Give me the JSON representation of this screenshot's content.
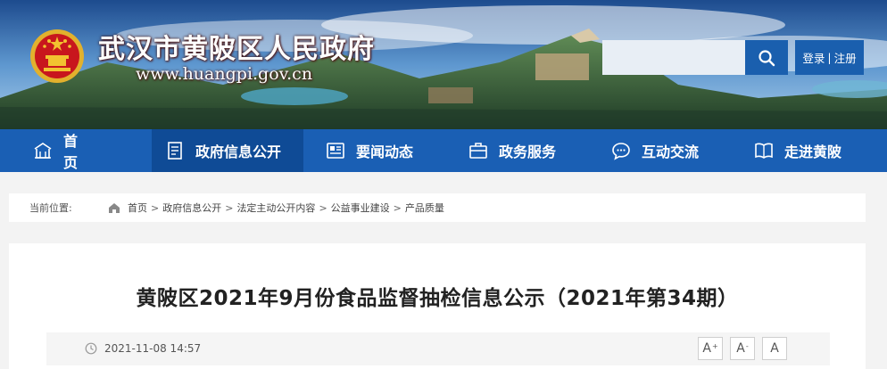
{
  "site": {
    "title": "武汉市黄陂区人民政府",
    "url": "www.huangpi.gov.cn",
    "emblem_icon": "national-emblem-icon"
  },
  "search": {
    "placeholder": "",
    "value": "",
    "icon": "search-icon"
  },
  "auth": {
    "login": "登录",
    "separator": "|",
    "register": "注册"
  },
  "nav": {
    "items": [
      {
        "label": "首页",
        "icon": "home-icon",
        "active": false
      },
      {
        "label": "政府信息公开",
        "icon": "document-icon",
        "active": true
      },
      {
        "label": "要闻动态",
        "icon": "newspaper-icon",
        "active": false
      },
      {
        "label": "政务服务",
        "icon": "briefcase-icon",
        "active": false
      },
      {
        "label": "互动交流",
        "icon": "chat-icon",
        "active": false
      },
      {
        "label": "走进黄陂",
        "icon": "book-icon",
        "active": false
      }
    ]
  },
  "breadcrumb": {
    "lead": "当前位置:",
    "separator": ">",
    "items": [
      "首页",
      "政府信息公开",
      "法定主动公开内容",
      "公益事业建设",
      "产品质量"
    ]
  },
  "article": {
    "title": "黄陂区2021年9月份食品监督抽检信息公示（2021年第34期）",
    "date": "2021-11-08 14:57",
    "font_controls": {
      "increase": "A",
      "increase_mark": "+",
      "decrease": "A",
      "decrease_mark": "-",
      "reset": "A"
    }
  },
  "colors": {
    "nav_bg": "#1a5fb4",
    "nav_active": "#0f4b96",
    "accent": "#1a5fae",
    "emblem_red": "#c8161d",
    "emblem_gold": "#f2c230"
  }
}
